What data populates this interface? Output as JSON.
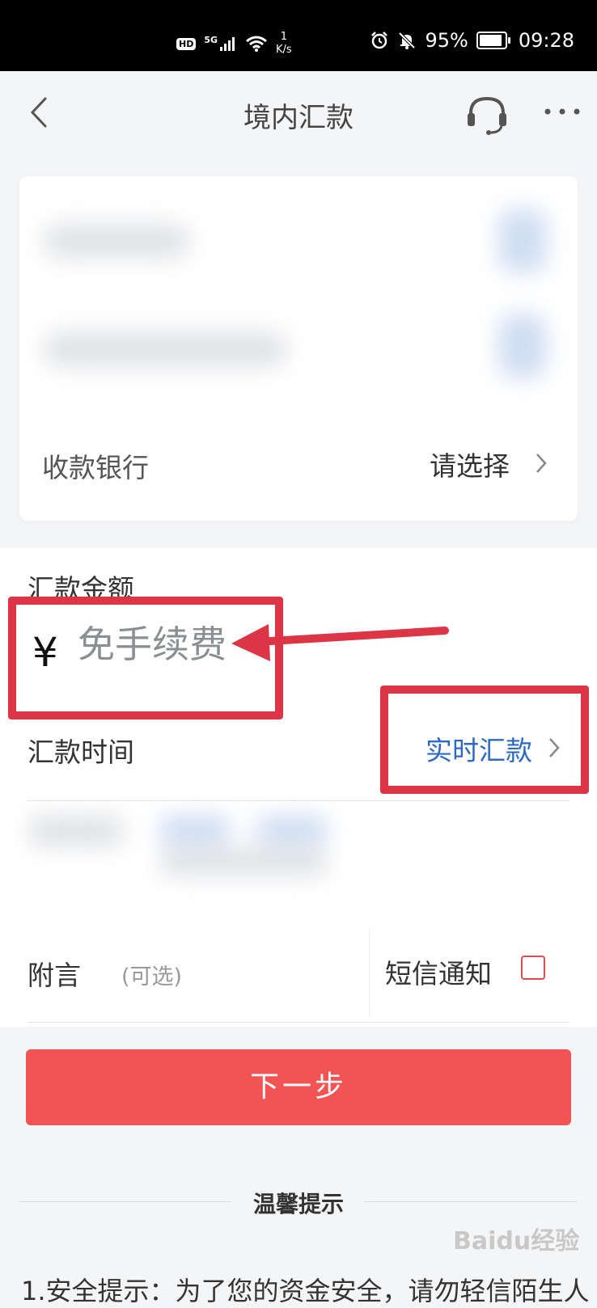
{
  "status_bar": {
    "hd": "HD",
    "network": "5G",
    "speed_value": "1",
    "speed_unit": "K/s",
    "battery": "95%",
    "time": "09:28"
  },
  "nav": {
    "title": "境内汇款"
  },
  "bank_row": {
    "label": "收款银行",
    "value": "请选择"
  },
  "amount": {
    "label": "汇款金额",
    "currency": "¥",
    "placeholder": "免手续费"
  },
  "transfer_time": {
    "label": "汇款时间",
    "value": "实时汇款"
  },
  "memo": {
    "label": "附言",
    "optional": "(可选)"
  },
  "sms": {
    "label": "短信通知"
  },
  "next_button": {
    "label": "下一步"
  },
  "tips": {
    "title": "温馨提示",
    "text": "1.安全提示：为了您的资金安全，请勿轻信陌生人"
  },
  "watermark": {
    "text": "Baidu经验"
  },
  "colors": {
    "primary_button": "#f25454",
    "link_blue": "#2d6bc2",
    "annotation_red": "#dc3545"
  }
}
